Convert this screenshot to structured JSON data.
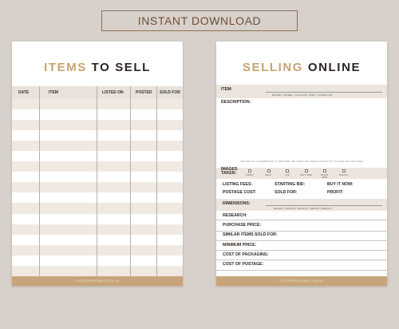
{
  "banner": {
    "label": "INSTANT DOWNLOAD"
  },
  "left_sheet": {
    "title_accent": "ITEMS",
    "title_rest": " TO SELL",
    "columns": [
      "DATE",
      "ITEM",
      "LISTED ON",
      "POSTED",
      "SOLD FOR"
    ],
    "row_count": 17,
    "footer": "LISTINGPRINTABLE.COM.AU"
  },
  "right_sheet": {
    "title_accent": "SELLING",
    "title_rest": " ONLINE",
    "item_label": "ITEM:",
    "item_sub": "BRAND  |  MODEL  |  COLOUR  |  SIZE  |  CONDITION",
    "description_label": "DESCRIPTION:",
    "description_hint": "USE ONE OF THE WEBPAGES TO DESCRIBE THE ITEM THEN USE BULLET POINTS TO HIGHLIGHT FEATURES",
    "images_label": "IMAGES TAKEN:",
    "image_options": [
      "FRONT",
      "BACK",
      "TOP",
      "LEFT SIDE",
      "RIGHT SIDE",
      "FAULTS"
    ],
    "listing_fees": "LISTING FEES:",
    "starting_bid": "STARTING BID:",
    "buy_it_now": "BUY IT NOW:",
    "postage_cost": "POSTAGE COST:",
    "sold_for": "SOLD FOR:",
    "profit": "PROFIT:",
    "dimensions_label": "DIMENSIONS:",
    "dimensions_sub": "HEIGHT  |  WIDTH  |  LENGTH  |  DEPTH  |  WEIGHT",
    "research_label": "RESEARCH:",
    "research_items": [
      "PURCHASE PRICE:",
      "SIMILAR ITEMS SOLD FOR:",
      "MINIMUM PRICE:",
      "COST OF PACKAGING:",
      "COST OF POSTAGE:"
    ],
    "footer": "LISTINGPRINTABLE.COM.AU"
  },
  "colors": {
    "accent": "#c7a272",
    "footer": "#c8a47a",
    "background": "#d8d1cb"
  }
}
